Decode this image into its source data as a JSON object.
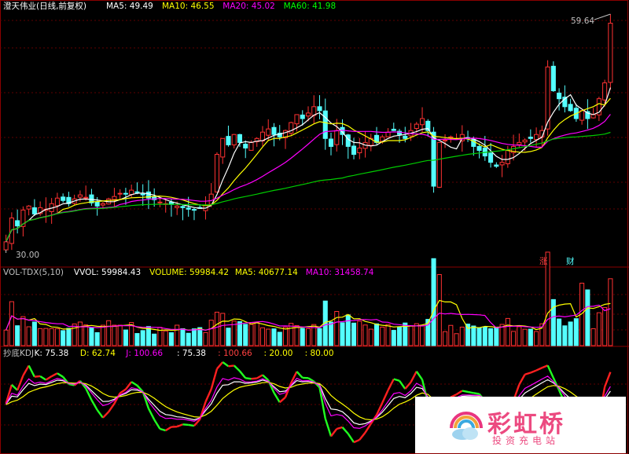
{
  "main_panel": {
    "stock_name": "澄天伟业",
    "period": "(日线,前复权)",
    "ma_labels": [
      {
        "text": "MA5: 49.49",
        "color": "#ffffff"
      },
      {
        "text": "MA10: 46.55",
        "color": "#ffff00"
      },
      {
        "text": "MA20: 45.02",
        "color": "#ff00ff"
      },
      {
        "text": "MA60: 41.98",
        "color": "#00ff00"
      }
    ],
    "high_marker": "59.64",
    "low_marker": "30.00",
    "event_tags": [
      "涨",
      "财"
    ]
  },
  "volume_panel": {
    "labels": [
      {
        "text": "VOL-TDX(5,10)",
        "color": "#c0c0c0"
      },
      {
        "text": "VVOL: 59984.43",
        "color": "#ffffff"
      },
      {
        "text": "VOLUME: 59984.42",
        "color": "#ffff00"
      },
      {
        "text": "MA5: 40677.14",
        "color": "#ffff00"
      },
      {
        "text": "MA10: 31458.74",
        "color": "#ff00ff"
      }
    ]
  },
  "kdj_panel": {
    "labels": [
      {
        "text": "抄底KDJ",
        "color": "#c0c0c0"
      },
      {
        "text": "K: 75.38",
        "color": "#ffffff"
      },
      {
        "text": "D: 62.74",
        "color": "#ffff00"
      },
      {
        "text": "J: 100.66",
        "color": "#ff00ff"
      },
      {
        "text": ": 75.38",
        "color": "#ffffff"
      },
      {
        "text": ": 100.66",
        "color": "#ff4040"
      },
      {
        "text": ": 20.00",
        "color": "#ffff00"
      },
      {
        "text": ": 80.00",
        "color": "#ffff00"
      }
    ]
  },
  "watermark": {
    "title": "彩虹桥",
    "subtitle": "投资充电站"
  },
  "chart_data": {
    "type": "candlestick",
    "series_closes": [
      31,
      34,
      33,
      35,
      35.5,
      34.5,
      35.3,
      35.1,
      35.8,
      36.5,
      36.2,
      35.8,
      36.4,
      36.9,
      36.6,
      35.9,
      35.5,
      35.8,
      36.4,
      36.7,
      37.1,
      37.0,
      37.5,
      37.2,
      36.9,
      36.5,
      36.3,
      36.0,
      35.8,
      35.7,
      35.5,
      35.3,
      35.1,
      35.0,
      35.2,
      35.6,
      37.0,
      42.0,
      44.0,
      43.2,
      44.5,
      43.5,
      42.8,
      43.5,
      44.0,
      44.8,
      45.2,
      44.5,
      44.2,
      45.0,
      46.0,
      47.0,
      46.5,
      47.2,
      48.0,
      47.5,
      44.0,
      43.0,
      45.0,
      44.5,
      43.0,
      42.0,
      42.8,
      43.5,
      44.0,
      43.5,
      44.2,
      44.8,
      45.0,
      44.5,
      44.0,
      45.0,
      45.8,
      46.5,
      45.0,
      38.0,
      43.5,
      43.8,
      44.2,
      44.0,
      44.5,
      44.0,
      43.0,
      42.5,
      41.8,
      41.0,
      40.5,
      41.0,
      42.5,
      43.0,
      43.5,
      43.8,
      44.0,
      44.5,
      45.0,
      53.0,
      50.0,
      49.0,
      48.0,
      47.5,
      46.5,
      47.5,
      46.5,
      47.0,
      49.0,
      51.0,
      58.5
    ],
    "price_range": [
      30.0,
      59.64
    ],
    "volume_ma": {
      "VOLUME": 59984.42,
      "MA5": 40677.14,
      "MA10": 31458.74
    },
    "kdj": {
      "K": 75.38,
      "D": 62.74,
      "J": 100.66,
      "levels": [
        20.0,
        80.0
      ]
    },
    "ma": {
      "MA5": 49.49,
      "MA10": 46.55,
      "MA20": 45.02,
      "MA60": 41.98
    }
  }
}
